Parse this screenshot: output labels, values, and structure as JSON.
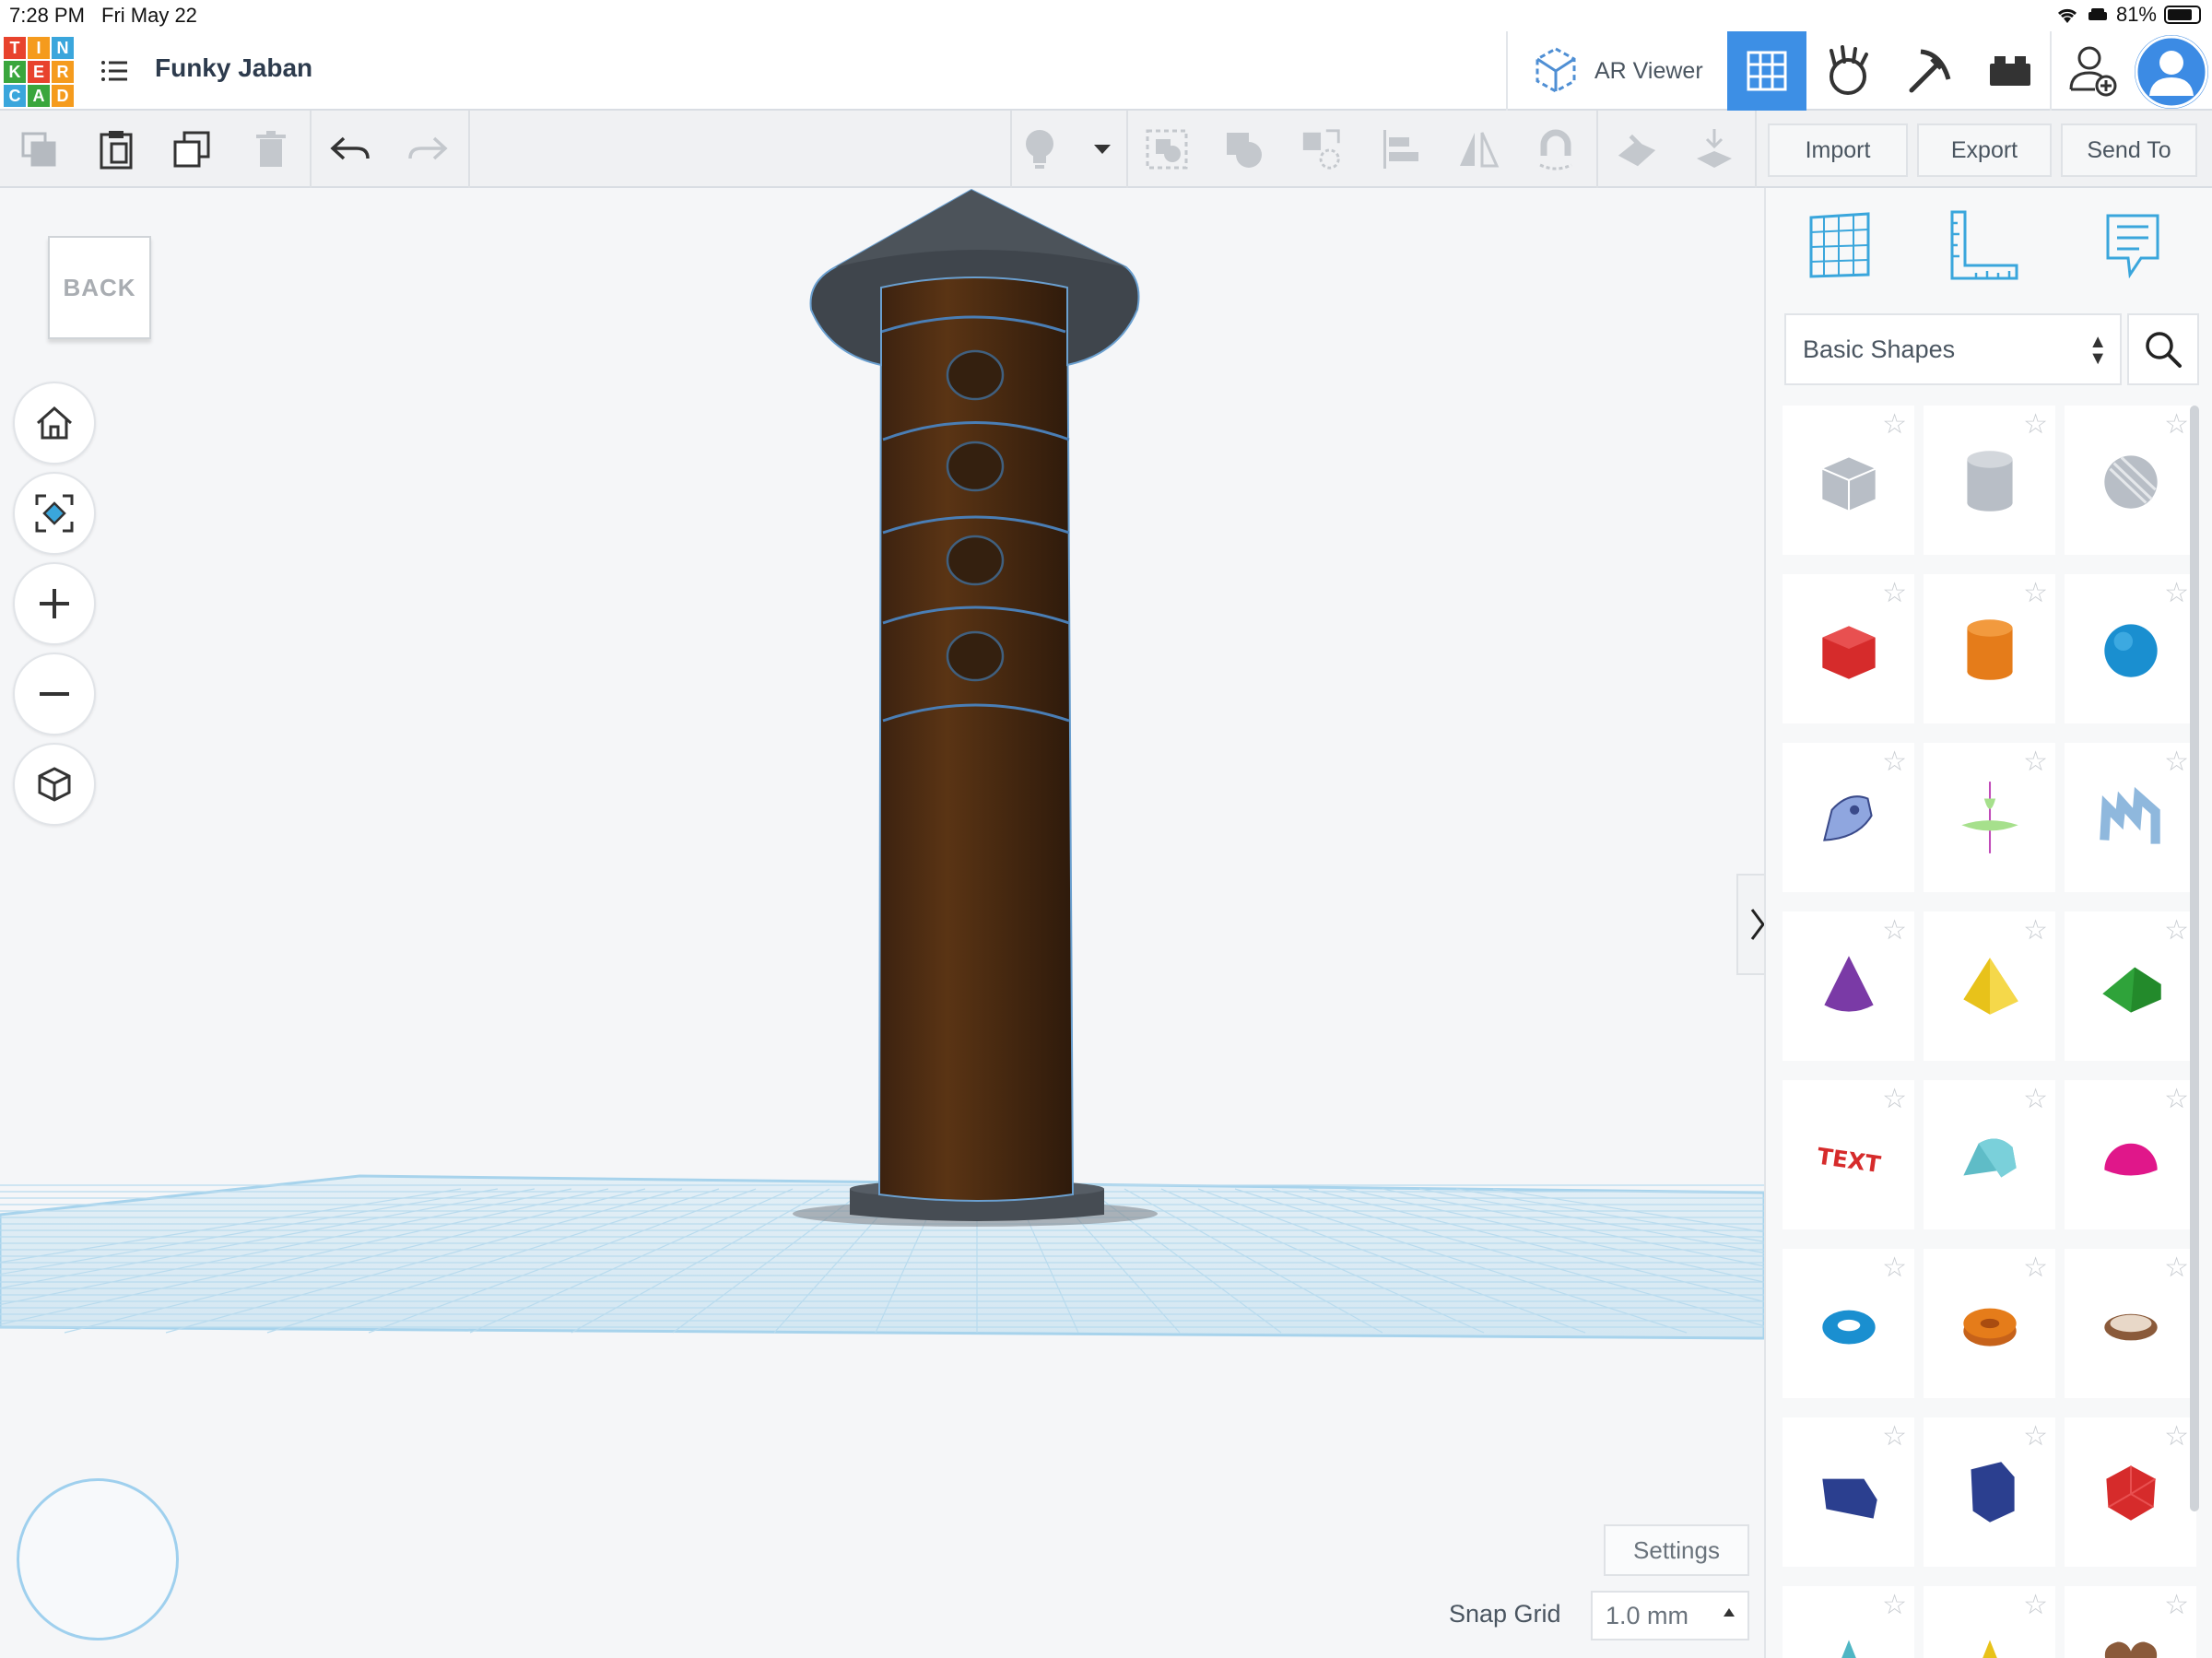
{
  "status_bar": {
    "time": "7:28 PM",
    "date": "Fri May 22",
    "battery": "81%",
    "battery_level": 0.81
  },
  "header": {
    "logo_letters": [
      "T",
      "I",
      "N",
      "K",
      "E",
      "R",
      "C",
      "A",
      "D"
    ],
    "logo_colors": [
      "#e8432d",
      "#f59b1d",
      "#3aa6dc",
      "#3aa63d",
      "#e8432d",
      "#f59b1d",
      "#3aa6dc",
      "#3aa63d",
      "#f59b1d"
    ],
    "project_title": "Funky Jaban",
    "ar_viewer_label": "AR Viewer",
    "accent_color": "#3d8fe5"
  },
  "toolbar": {
    "import_label": "Import",
    "export_label": "Export",
    "send_to_label": "Send To"
  },
  "canvas": {
    "viewcube_face": "BACK",
    "settings_label": "Settings",
    "snap_grid_label": "Snap Grid",
    "snap_grid_value": "1.0 mm",
    "model_color": "#4a2a10",
    "roof_color": "#3f454c"
  },
  "panel": {
    "library_selected": "Basic Shapes",
    "shapes": [
      {
        "name": "box-hole",
        "color": "#b8bec6"
      },
      {
        "name": "cylinder-hole",
        "color": "#b8bec6"
      },
      {
        "name": "sphere-hole",
        "color": "#b8bec6"
      },
      {
        "name": "box",
        "color": "#d62b2b"
      },
      {
        "name": "cylinder",
        "color": "#e57c1a"
      },
      {
        "name": "sphere",
        "color": "#1a8fd0"
      },
      {
        "name": "scribble",
        "color": "#8fa6df"
      },
      {
        "name": "shape-generator",
        "color": "#a6e08c"
      },
      {
        "name": "text-3d-blue",
        "color": "#8fb8dd"
      },
      {
        "name": "cone",
        "color": "#7a3aa6"
      },
      {
        "name": "pyramid",
        "color": "#e8c21a"
      },
      {
        "name": "roof",
        "color": "#2fa33a"
      },
      {
        "name": "text",
        "color": "#d62b2b"
      },
      {
        "name": "round-roof",
        "color": "#5fbcc7"
      },
      {
        "name": "half-sphere",
        "color": "#e0178a"
      },
      {
        "name": "torus",
        "color": "#1a8fd0"
      },
      {
        "name": "tube",
        "color": "#e57c1a"
      },
      {
        "name": "ring",
        "color": "#8a5a3a"
      },
      {
        "name": "wedge",
        "color": "#2b3f8f"
      },
      {
        "name": "polygon",
        "color": "#2b3f8f"
      },
      {
        "name": "icosahedron",
        "color": "#d62b2b"
      },
      {
        "name": "star-teal",
        "color": "#4fb6c4"
      },
      {
        "name": "star-yellow",
        "color": "#e8c21a"
      },
      {
        "name": "heart",
        "color": "#8a5a3a"
      }
    ]
  }
}
